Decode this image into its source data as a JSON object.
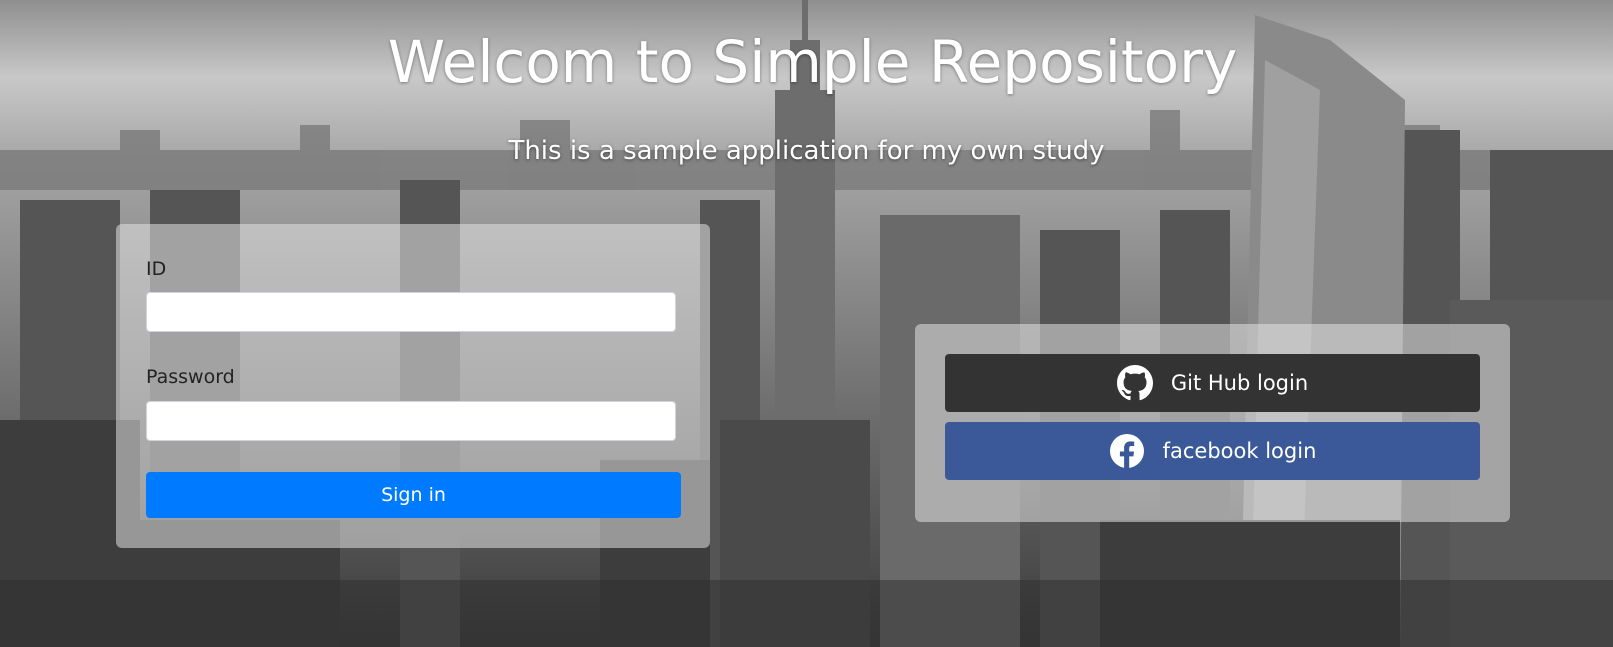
{
  "header": {
    "title": "Welcom to Simple Repository",
    "subtitle": "This is a sample application for my own study"
  },
  "login_form": {
    "id_label": "ID",
    "id_value": "",
    "password_label": "Password",
    "password_value": "",
    "signin_label": "Sign in"
  },
  "social_login": {
    "github_label": "Git Hub login",
    "github_icon": "github-icon",
    "facebook_label": "facebook login",
    "facebook_icon": "facebook-icon"
  },
  "colors": {
    "signin_button": "#007bff",
    "github_button": "#333333",
    "facebook_button": "#3b5998"
  }
}
